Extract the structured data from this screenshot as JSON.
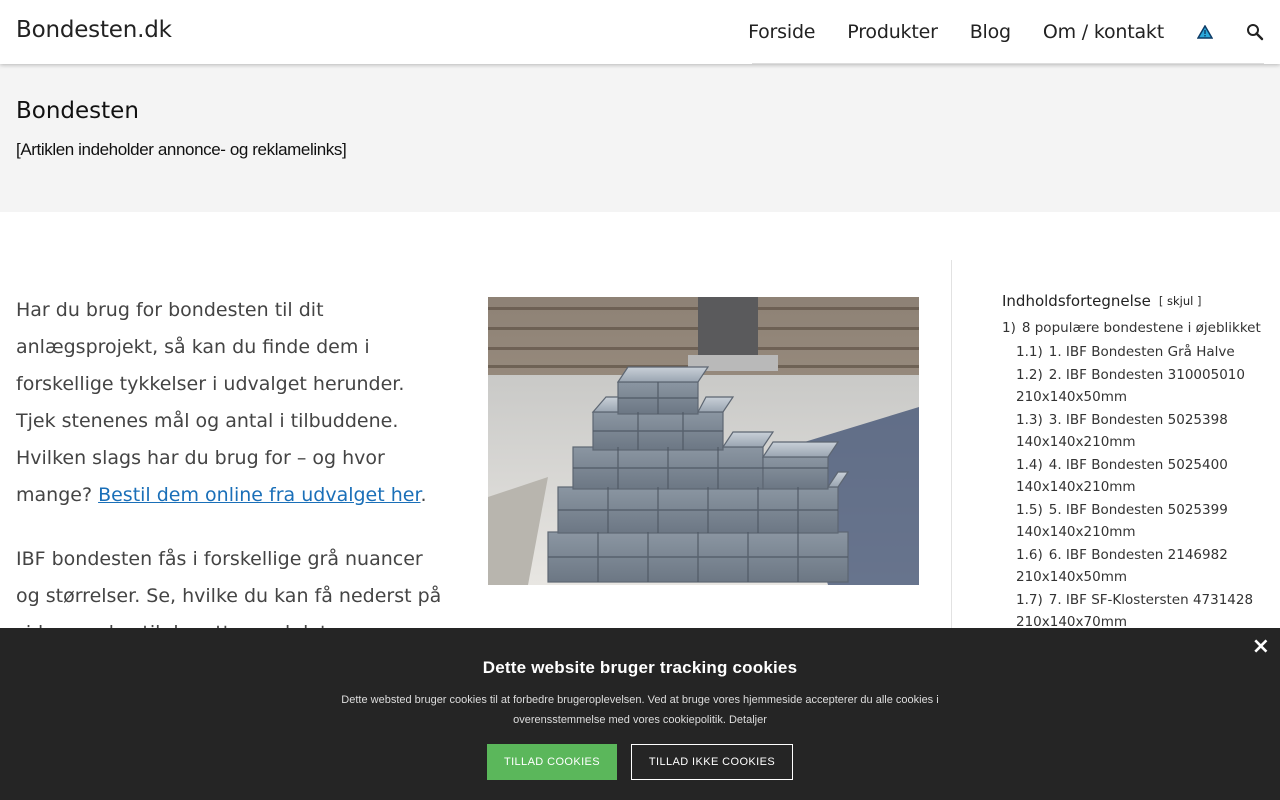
{
  "header": {
    "logo": "Bondesten.dk",
    "nav": [
      "Forside",
      "Produkter",
      "Blog",
      "Om / kontakt"
    ]
  },
  "title_band": {
    "title": "Bondesten",
    "disclaimer": "[Artiklen indeholder annonce- og reklamelinks]"
  },
  "article": {
    "p1_text": "Har du brug for bondesten til dit anlægsprojekt, så kan du finde dem i forskellige tykkelser i udvalget herunder. Tjek stenenes mål og antal i tilbuddene. Hvilken slags har du brug for – og hvor mange? ",
    "p1_link": "Bestil dem online fra udvalget her",
    "p1_end": ".",
    "p2_text": "IBF bondesten fås i forskellige grå nuancer og størrelser. Se, hvilke du kan få nederst på siden, og bestil de rette med det samme – så"
  },
  "toc": {
    "title": "Indholdsfortegnelse",
    "toggle": "skjul",
    "items": [
      {
        "num": "1)",
        "label": "8 populære bondestene i øjeblikket",
        "level": 1
      },
      {
        "num": "1.1)",
        "label": "1. IBF Bondesten Grå Halve",
        "level": 2
      },
      {
        "num": "1.2)",
        "label": "2. IBF Bondesten 310005010 210x140x50mm",
        "level": 2
      },
      {
        "num": "1.3)",
        "label": "3. IBF Bondesten 5025398 140x140x210mm",
        "level": 2
      },
      {
        "num": "1.4)",
        "label": "4. IBF Bondesten 5025400 140x140x210mm",
        "level": 2
      },
      {
        "num": "1.5)",
        "label": "5. IBF Bondesten 5025399 140x140x210mm",
        "level": 2
      },
      {
        "num": "1.6)",
        "label": "6. IBF Bondesten 2146982 210x140x50mm",
        "level": 2
      },
      {
        "num": "1.7)",
        "label": "7. IBF SF-Klostersten 4731428 210x140x70mm",
        "level": 2
      }
    ]
  },
  "cookie": {
    "title": "Dette website bruger tracking cookies",
    "text": "Dette websted bruger cookies til at forbedre brugeroplevelsen. Ved at bruge vores hjemmeside accepterer du alle cookies i overensstemmelse med vores cookiepolitik.",
    "details_link": "Detaljer",
    "allow": "TILLAD COOKIES",
    "deny": "TILLAD IKKE COOKIES",
    "close": "×"
  },
  "icons": {
    "nav_alert": "warning-triangle-icon",
    "nav_search": "search-icon"
  },
  "colors": {
    "link": "#1a6fb8",
    "allow_button": "#5bb75b",
    "cookie_bg": "#252525",
    "title_band_bg": "#f4f4f4"
  }
}
